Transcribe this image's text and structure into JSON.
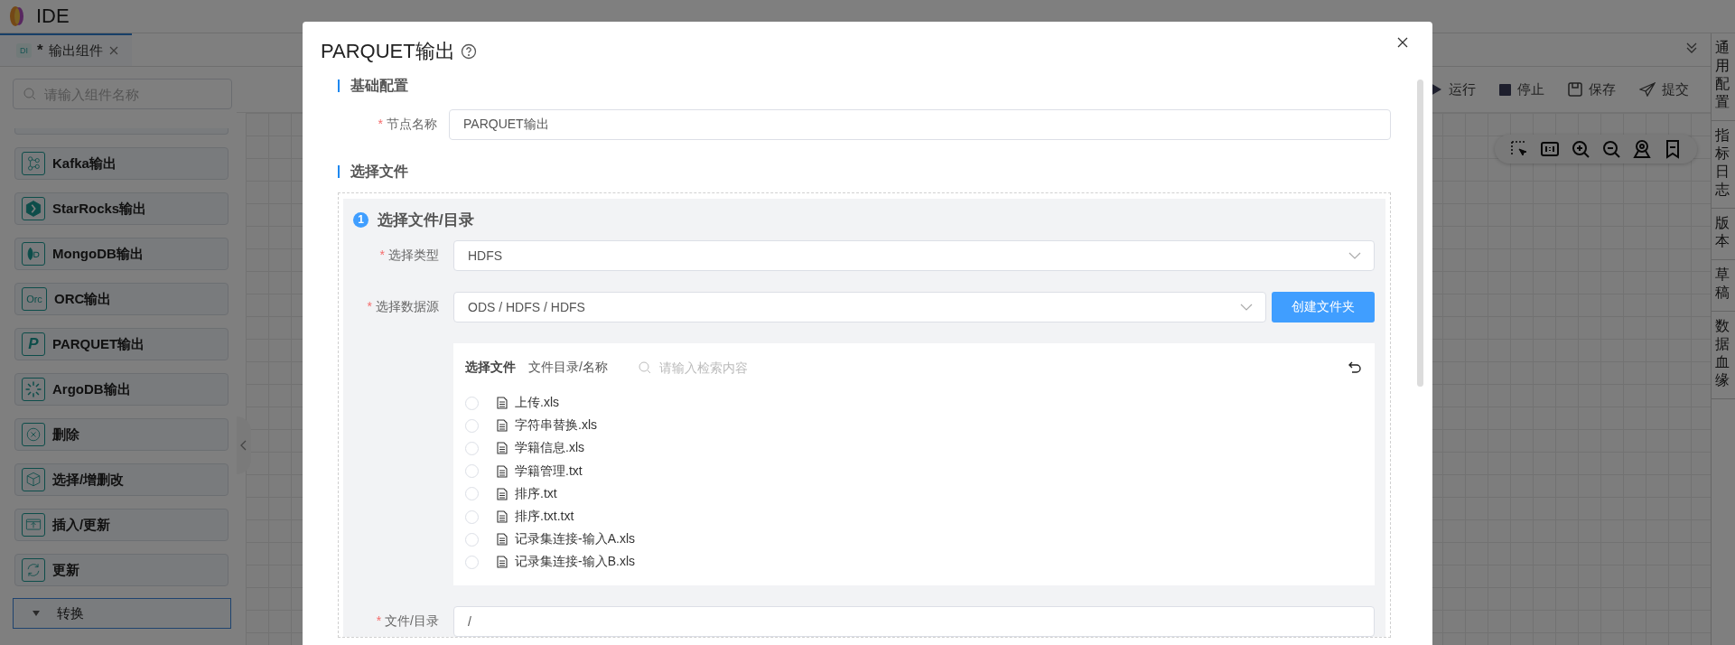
{
  "app": {
    "title": "IDE"
  },
  "tabs": [
    {
      "badge": "DI",
      "mark": "*",
      "label": "输出组件",
      "selected": true
    }
  ],
  "component_search": {
    "placeholder": "请输入组件名称"
  },
  "components": [
    {
      "kind": "kafka",
      "label": "Kafka输出"
    },
    {
      "kind": "starrocks",
      "label": "StarRocks输出"
    },
    {
      "kind": "mongodb",
      "label": "MongoDB输出"
    },
    {
      "kind": "orc",
      "badge": "Orc",
      "label": "ORC输出"
    },
    {
      "kind": "parquet",
      "badge": "P",
      "label": "PARQUET输出"
    },
    {
      "kind": "argodb",
      "label": "ArgoDB输出"
    },
    {
      "kind": "delete",
      "label": "删除"
    },
    {
      "kind": "crud",
      "label": "选择/增删改"
    },
    {
      "kind": "upsert",
      "label": "插入/更新"
    },
    {
      "kind": "update",
      "label": "更新"
    }
  ],
  "category": {
    "label": "转换",
    "expanded": true
  },
  "toolbar": [
    {
      "kind": "run",
      "label": "运行"
    },
    {
      "kind": "stop",
      "label": "停止"
    },
    {
      "kind": "save",
      "label": "保存"
    },
    {
      "kind": "submit",
      "label": "提交"
    }
  ],
  "side_tabs": [
    {
      "label": "通用配置"
    },
    {
      "label": "指标日志"
    },
    {
      "label": "版本"
    },
    {
      "label": "草稿"
    },
    {
      "label": "数据血缘"
    }
  ],
  "dialog": {
    "title": "PARQUET输出",
    "sections": [
      {
        "heading": "基础配置",
        "fields": [
          {
            "kind": "text",
            "mark": "*",
            "label": "节点名称",
            "value": "PARQUET输出"
          }
        ]
      },
      {
        "heading": "选择文件",
        "step": {
          "number": "1",
          "title": "选择文件/目录",
          "fields": [
            {
              "kind": "select",
              "mark": "*",
              "label": "选择类型",
              "value": "HDFS"
            },
            {
              "kind": "select",
              "mark": "*",
              "label": "选择数据源",
              "value": "ODS / HDFS / HDFS",
              "button": "创建文件夹"
            },
            {
              "kind": "files",
              "title": "选择文件",
              "column": "文件目录/名称",
              "search_placeholder": "请输入检索内容",
              "files": [
                {
                  "name": "上传.xls",
                  "selected": false
                },
                {
                  "name": "字符串替换.xls",
                  "selected": false
                },
                {
                  "name": "学籍信息.xls",
                  "selected": false
                },
                {
                  "name": "学籍管理.txt",
                  "selected": false
                },
                {
                  "name": "排序.txt",
                  "selected": false
                },
                {
                  "name": "排序.txt.txt",
                  "selected": false
                },
                {
                  "name": "记录集连接-输入A.xls",
                  "selected": false
                },
                {
                  "name": "记录集连接-输入B.xls",
                  "selected": false
                }
              ]
            },
            {
              "kind": "text",
              "mark": "*",
              "label": "文件/目录",
              "value": "/"
            }
          ]
        }
      }
    ]
  }
}
